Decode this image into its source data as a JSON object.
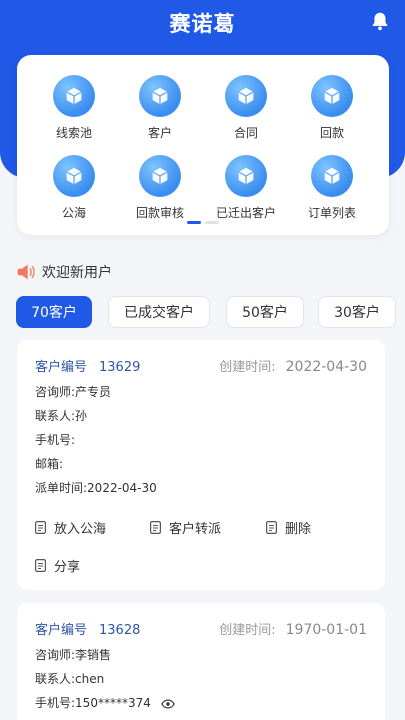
{
  "header": {
    "title": "赛诺葛",
    "bell_icon": "bell-icon",
    "color": "#1f59e6"
  },
  "menu": {
    "items": [
      {
        "label": "线索池",
        "icon": "cube-icon"
      },
      {
        "label": "客户",
        "icon": "cube-icon"
      },
      {
        "label": "合同",
        "icon": "cube-icon"
      },
      {
        "label": "回款",
        "icon": "cube-icon"
      },
      {
        "label": "公海",
        "icon": "cube-icon"
      },
      {
        "label": "回款审核",
        "icon": "cube-icon"
      },
      {
        "label": "已迁出客户",
        "icon": "cube-icon"
      },
      {
        "label": "订单列表",
        "icon": "cube-icon"
      }
    ],
    "pager": {
      "current_page": 1,
      "total_pages": 2
    }
  },
  "notice": {
    "icon": "speaker-icon",
    "text": "欢迎新用户"
  },
  "filters": [
    {
      "label": "70客户",
      "active": true
    },
    {
      "label": "已成交客户",
      "active": false
    },
    {
      "label": "50客户",
      "active": false
    },
    {
      "label": "30客户",
      "active": false
    }
  ],
  "customers": [
    {
      "no_label": "客户编号",
      "no": "13629",
      "created_label": "创建时间:",
      "created": "2022-04-30",
      "consultant": "咨询师:产专员",
      "contact": "联系人:孙",
      "phone": "手机号:",
      "email": "邮箱:",
      "dispatch": "派单时间:2022-04-30",
      "actions": {
        "to_pool": "放入公海",
        "transfer": "客户转派",
        "delete": "删除",
        "share": "分享"
      }
    },
    {
      "no_label": "客户编号",
      "no": "13628",
      "created_label": "创建时间:",
      "created": "1970-01-01",
      "consultant": "咨询师:李销售",
      "contact": "联系人:chen",
      "phone": "手机号:150*****374",
      "eye_icon": "eye-icon"
    }
  ]
}
